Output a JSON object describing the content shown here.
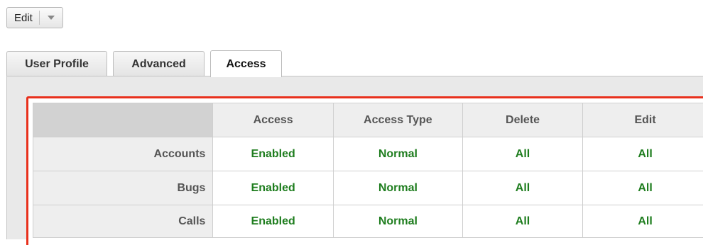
{
  "toolbar": {
    "edit_label": "Edit",
    "dropdown_icon": "caret-down-icon"
  },
  "tabs": [
    {
      "label": "User Profile",
      "active": false
    },
    {
      "label": "Advanced",
      "active": false
    },
    {
      "label": "Access",
      "active": true
    }
  ],
  "access_table": {
    "columns": [
      "",
      "Access",
      "Access Type",
      "Delete",
      "Edit"
    ],
    "rows": [
      {
        "module": "Accounts",
        "access": "Enabled",
        "access_type": "Normal",
        "delete": "All",
        "edit": "All"
      },
      {
        "module": "Bugs",
        "access": "Enabled",
        "access_type": "Normal",
        "delete": "All",
        "edit": "All"
      },
      {
        "module": "Calls",
        "access": "Enabled",
        "access_type": "Normal",
        "delete": "All",
        "edit": "All"
      }
    ]
  },
  "colors": {
    "highlight_border": "#e8301c",
    "value_text": "#1e7d1e",
    "header_bg": "#eeeeee",
    "panel_bg": "#e9e9e9"
  }
}
